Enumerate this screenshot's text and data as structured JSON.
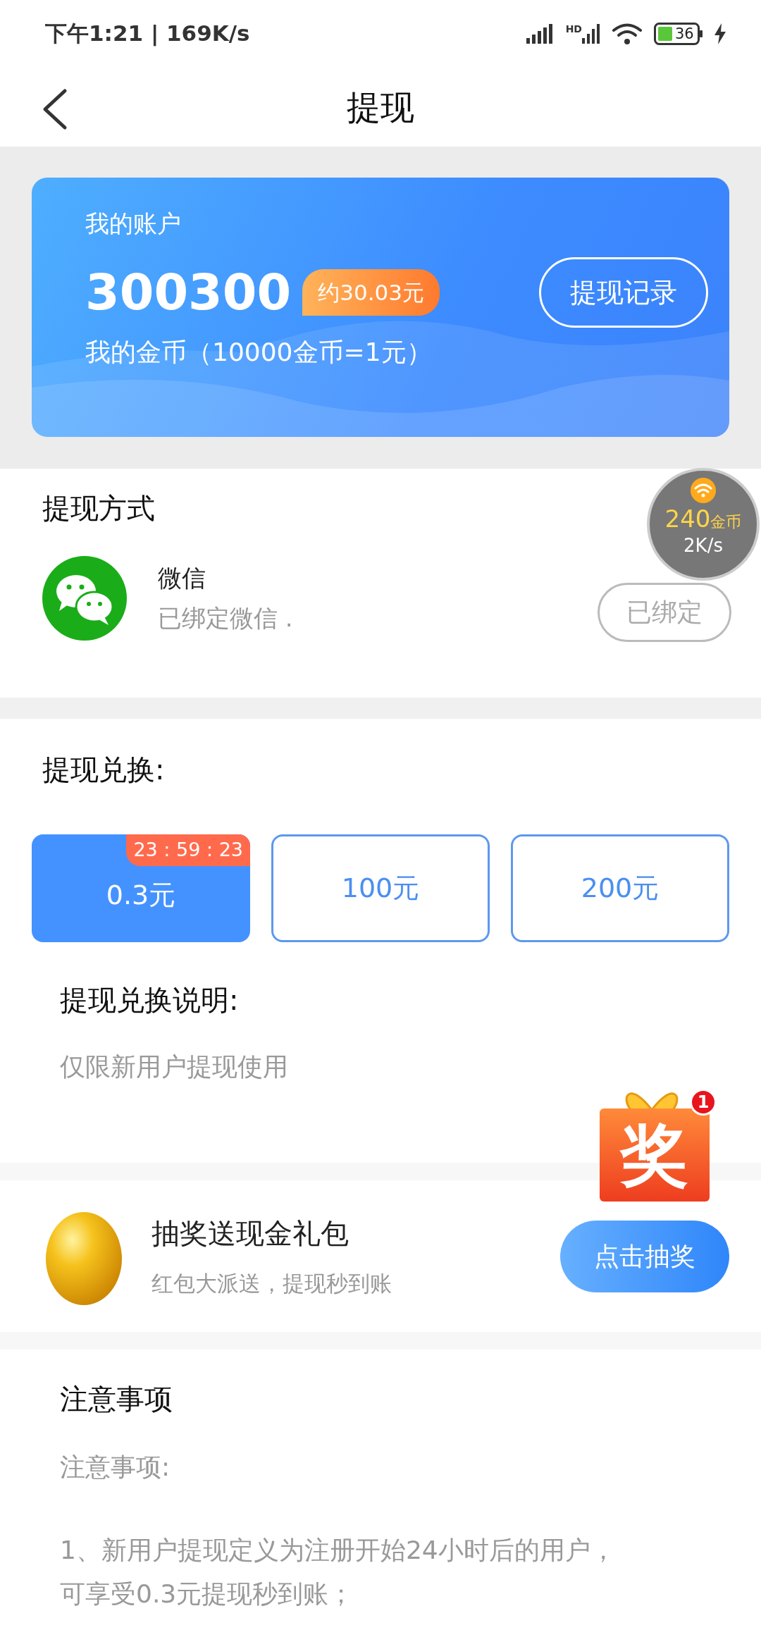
{
  "status_bar": {
    "time_speed": "下午1:21 | 169K/s",
    "hd_label": "HD",
    "battery": "36"
  },
  "header": {
    "title": "提现"
  },
  "account": {
    "label": "我的账户",
    "coins": "300300",
    "approx": "约30.03元",
    "record_button": "提现记录",
    "rate": "我的金币（10000金币=1元）"
  },
  "method": {
    "title": "提现方式",
    "items": [
      {
        "name": "微信",
        "status": "已绑定微信 .",
        "button": "已绑定"
      }
    ]
  },
  "floating_widget": {
    "coins": "240",
    "unit": "金币",
    "speed": "2K/s"
  },
  "exchange": {
    "title": "提现兑换:",
    "options": [
      {
        "amount": "0.3元",
        "timer": "23 : 59 : 23",
        "selected": true
      },
      {
        "amount": "100元",
        "selected": false
      },
      {
        "amount": "200元",
        "selected": false
      }
    ],
    "note_title": "提现兑换说明:",
    "note": "仅限新用户提现使用"
  },
  "gift_float": {
    "label": "奖",
    "badge": "1"
  },
  "lottery": {
    "title": "抽奖送现金礼包",
    "subtitle": "红包大派送，提现秒到账",
    "button": "点击抽奖"
  },
  "notes": {
    "title": "注意事项",
    "paragraphs": [
      "注意事项:",
      "1、新用户提现定义为注册开始24小时后的用户，可享受0.3元提现秒到账；"
    ]
  }
}
